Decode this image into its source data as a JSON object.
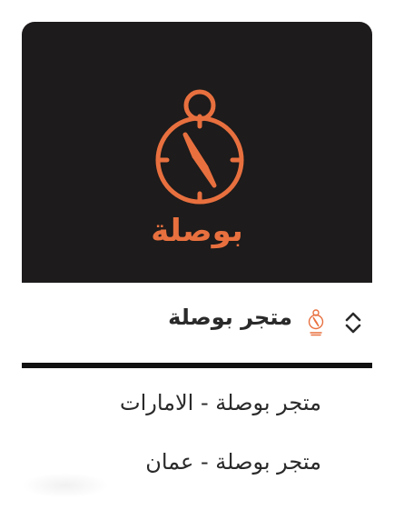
{
  "logo": {
    "icon": "compass-icon",
    "wordmark": "بوصلة",
    "accent_color": "#e8703f",
    "background_color": "#1d1b1b"
  },
  "switcher": {
    "current_store": "متجر بوصلة",
    "logo_icon": "compass-icon",
    "toggle_icon": "chevron-up-down-icon"
  },
  "menu": {
    "items": [
      {
        "label": "متجر بوصلة - الامارات"
      },
      {
        "label": "متجر بوصلة - عمان"
      }
    ]
  }
}
